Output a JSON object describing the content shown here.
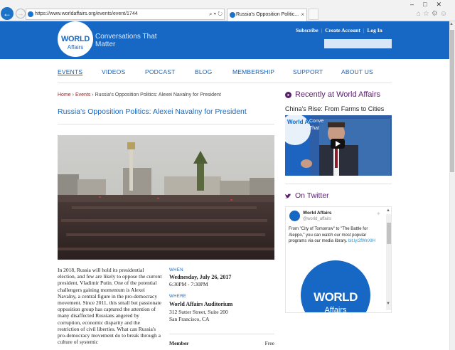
{
  "browser": {
    "url": "https://www.worldaffairs.org/events/event/1744",
    "tab_title": "Russia's Opposition Politic...",
    "tab_close": "×",
    "addr_tools": "⌕ ▾ ↻",
    "back_glyph": "←",
    "fwd_glyph": "→",
    "window_controls": "–□✕",
    "toolbar_icons": "⌂☆⚙☺"
  },
  "header": {
    "logo_world": "WORLD",
    "logo_affairs": "Affairs",
    "tagline": "Conversations That Matter",
    "top_links": [
      "Subscribe",
      "Create Account",
      "Log In"
    ],
    "search_value": ""
  },
  "nav": {
    "items": [
      "EVENTS",
      "VIDEOS",
      "PODCAST",
      "BLOG",
      "MEMBERSHIP",
      "SUPPORT",
      "ABOUT US"
    ]
  },
  "breadcrumb": {
    "home": "Home",
    "sep": "›",
    "events": "Events",
    "current": "Russia's Opposition Politics: Alexei Navalny for President"
  },
  "event": {
    "title": "Russia's Opposition Politics: Alexei Navalny for President",
    "description": "In 2018, Russia will hold its presidential election, and few are likely to oppose the current president, Vladimir Putin. One of the potential challengers gaining momentum is Alexei Navalny, a central figure in the pro-democracy movement. Since 2011, this small but passionate opposition group has captured the attention of many disaffected Russians angered by corruption, economic disparity and the restriction of civil liberties. What can Russia's pro-democracy movement do to break through a culture of systemic",
    "when_label": "WHEN",
    "when_date": "Wednesday, July 26, 2017",
    "when_time": "6:30PM - 7:30PM",
    "where_label": "WHERE",
    "where_name": "World Affairs Auditorium",
    "where_address_1": "312 Sutter Street, Suite 200",
    "where_address_2": "San Francisco, CA",
    "price_label": "Member",
    "price_value": "Free"
  },
  "sidebar": {
    "recent_heading": "Recently at World Affairs",
    "recent_title": "China's Rise: From Farms to Cities",
    "video_overlay_1": "Conve",
    "video_overlay_2": "That",
    "video_logo": "World Affairs",
    "twitter_heading": "On Twitter",
    "tweet": {
      "name": "World Affairs",
      "handle": "@world_affairs",
      "text": "From \"City of Tomorrow\" to \"The Battle for Aleppo,\" you can watch our most popular programs via our media library.",
      "link": "bit.ly/2fWnXIH",
      "logo_line_1": "WORLD",
      "logo_line_2": "Affairs"
    }
  },
  "colors": {
    "brand_blue": "#1668c4",
    "heading_purple": "#5a1e6e",
    "crumb_link": "#8a2a2a"
  }
}
